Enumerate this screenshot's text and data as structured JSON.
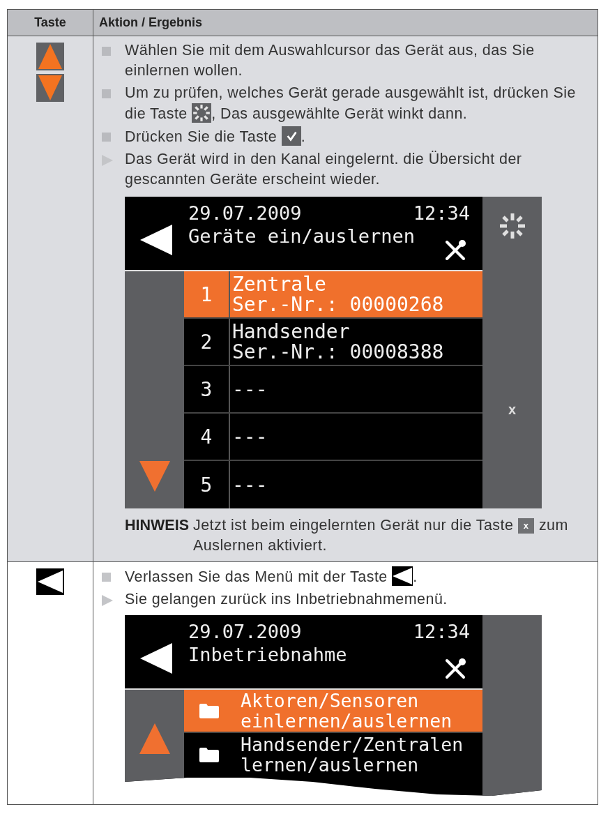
{
  "table": {
    "columns": [
      "Taste",
      "Aktion / Ergebnis"
    ],
    "rows": [
      {
        "kind": "up-down",
        "items": [
          {
            "kind": "step",
            "segments": [
              {
                "kind": "text",
                "text": "Wählen Sie mit dem Auswahlcursor das Gerät aus, das Sie einlernen wollen."
              }
            ]
          },
          {
            "kind": "step",
            "segments": [
              {
                "kind": "text",
                "text": "Um zu prüfen, welches Gerät gerade ausgewählt ist, drücken Sie die Taste "
              },
              {
                "kind": "key-sun"
              },
              {
                "kind": "text",
                "text": ", Das ausgewählte Gerät winkt dann."
              }
            ]
          },
          {
            "kind": "step",
            "segments": [
              {
                "kind": "text",
                "text": "Drücken Sie die Taste "
              },
              {
                "kind": "key-check"
              },
              {
                "kind": "text",
                "text": "."
              }
            ]
          },
          {
            "kind": "result",
            "segments": [
              {
                "kind": "text",
                "text": "Das Gerät wird in den Kanal eingelernt. die Übersicht der gescannten Geräte erscheint wieder."
              }
            ]
          }
        ],
        "screen": {
          "date": "29.07.2009",
          "time": "12:34",
          "title": "Geräte ein/auslernen",
          "torn": false,
          "scroll_arrow": {
            "kind": "down"
          },
          "side_buttons": [
            {
              "kind": "sun"
            },
            {
              "kind": "label",
              "label": "x"
            }
          ],
          "list": [
            {
              "kind": "number",
              "number": "1",
              "lines": [
                "Zentrale",
                "Ser.-Nr.: 00000268"
              ],
              "selected": true
            },
            {
              "kind": "number",
              "number": "2",
              "lines": [
                "Handsender",
                "Ser.-Nr.: 00008388"
              ],
              "selected": false
            },
            {
              "kind": "number",
              "number": "3",
              "lines": [
                "---"
              ],
              "selected": false
            },
            {
              "kind": "number",
              "number": "4",
              "lines": [
                "---"
              ],
              "selected": false
            },
            {
              "kind": "number",
              "number": "5",
              "lines": [
                "---"
              ],
              "selected": false
            }
          ]
        },
        "note": {
          "label": "HINWEIS",
          "segments": [
            {
              "kind": "text",
              "text": "Jetzt ist beim eingelernten Gerät nur die Taste "
            },
            {
              "kind": "key-label",
              "label": "x"
            },
            {
              "kind": "text",
              "text": " zum Auslernen aktiviert."
            }
          ]
        }
      },
      {
        "kind": "back",
        "items": [
          {
            "kind": "step",
            "segments": [
              {
                "kind": "text",
                "text": "Verlassen Sie das Menü mit der Taste "
              },
              {
                "kind": "key-back"
              },
              {
                "kind": "text",
                "text": "."
              }
            ]
          },
          {
            "kind": "result",
            "segments": [
              {
                "kind": "text",
                "text": "Sie gelangen zurück ins Inbetriebnahmemenü."
              }
            ]
          }
        ],
        "screen": {
          "date": "29.07.2009",
          "time": "12:34",
          "title": "Inbetriebnahme",
          "torn": true,
          "scroll_arrow": {
            "kind": "up"
          },
          "list": [
            {
              "kind": "folder",
              "lines": [
                "Aktoren/Sensoren",
                "einlernen/auslernen"
              ],
              "selected": true
            },
            {
              "kind": "folder",
              "lines": [
                "Handsender/Zentralen",
                "lernen/auslernen"
              ],
              "selected": false
            }
          ]
        }
      }
    ]
  }
}
